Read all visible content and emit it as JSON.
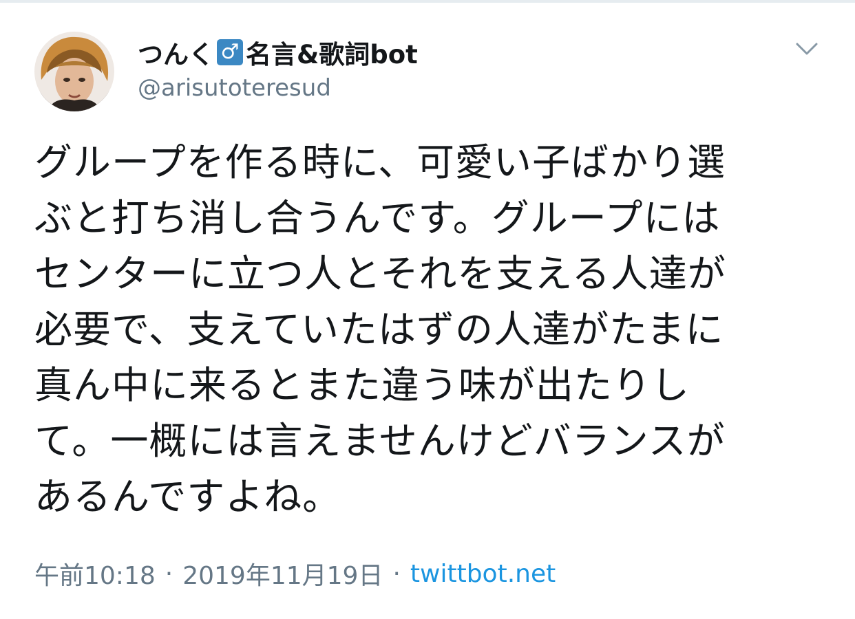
{
  "tweet": {
    "display_name_prefix": "つんく",
    "male_symbol": "♂",
    "display_name_suffix": "名言&歌詞bot",
    "handle": "@arisutoteresud",
    "text_lines": [
      "グループを作る時に、可愛い子ばかり選",
      "ぶと打ち消し合うんです。グループには",
      "センターに立つ人とそれを支える人達が",
      "必要で、支えていたはずの人達がたまに",
      "真ん中に来るとまた違う味が出たりし",
      "て。一概には言えませんけどバランスが",
      "あるんですよね。"
    ],
    "time": "午前10:18",
    "date": "2019年11月19日",
    "separator": "·",
    "source": "twittbot.net"
  },
  "icons": {
    "menu": "chevron-down-icon",
    "avatar": "avatar-photo"
  },
  "colors": {
    "text": "#14171a",
    "secondary": "#657786",
    "link": "#1b95e0",
    "badge": "#3b88c3"
  }
}
